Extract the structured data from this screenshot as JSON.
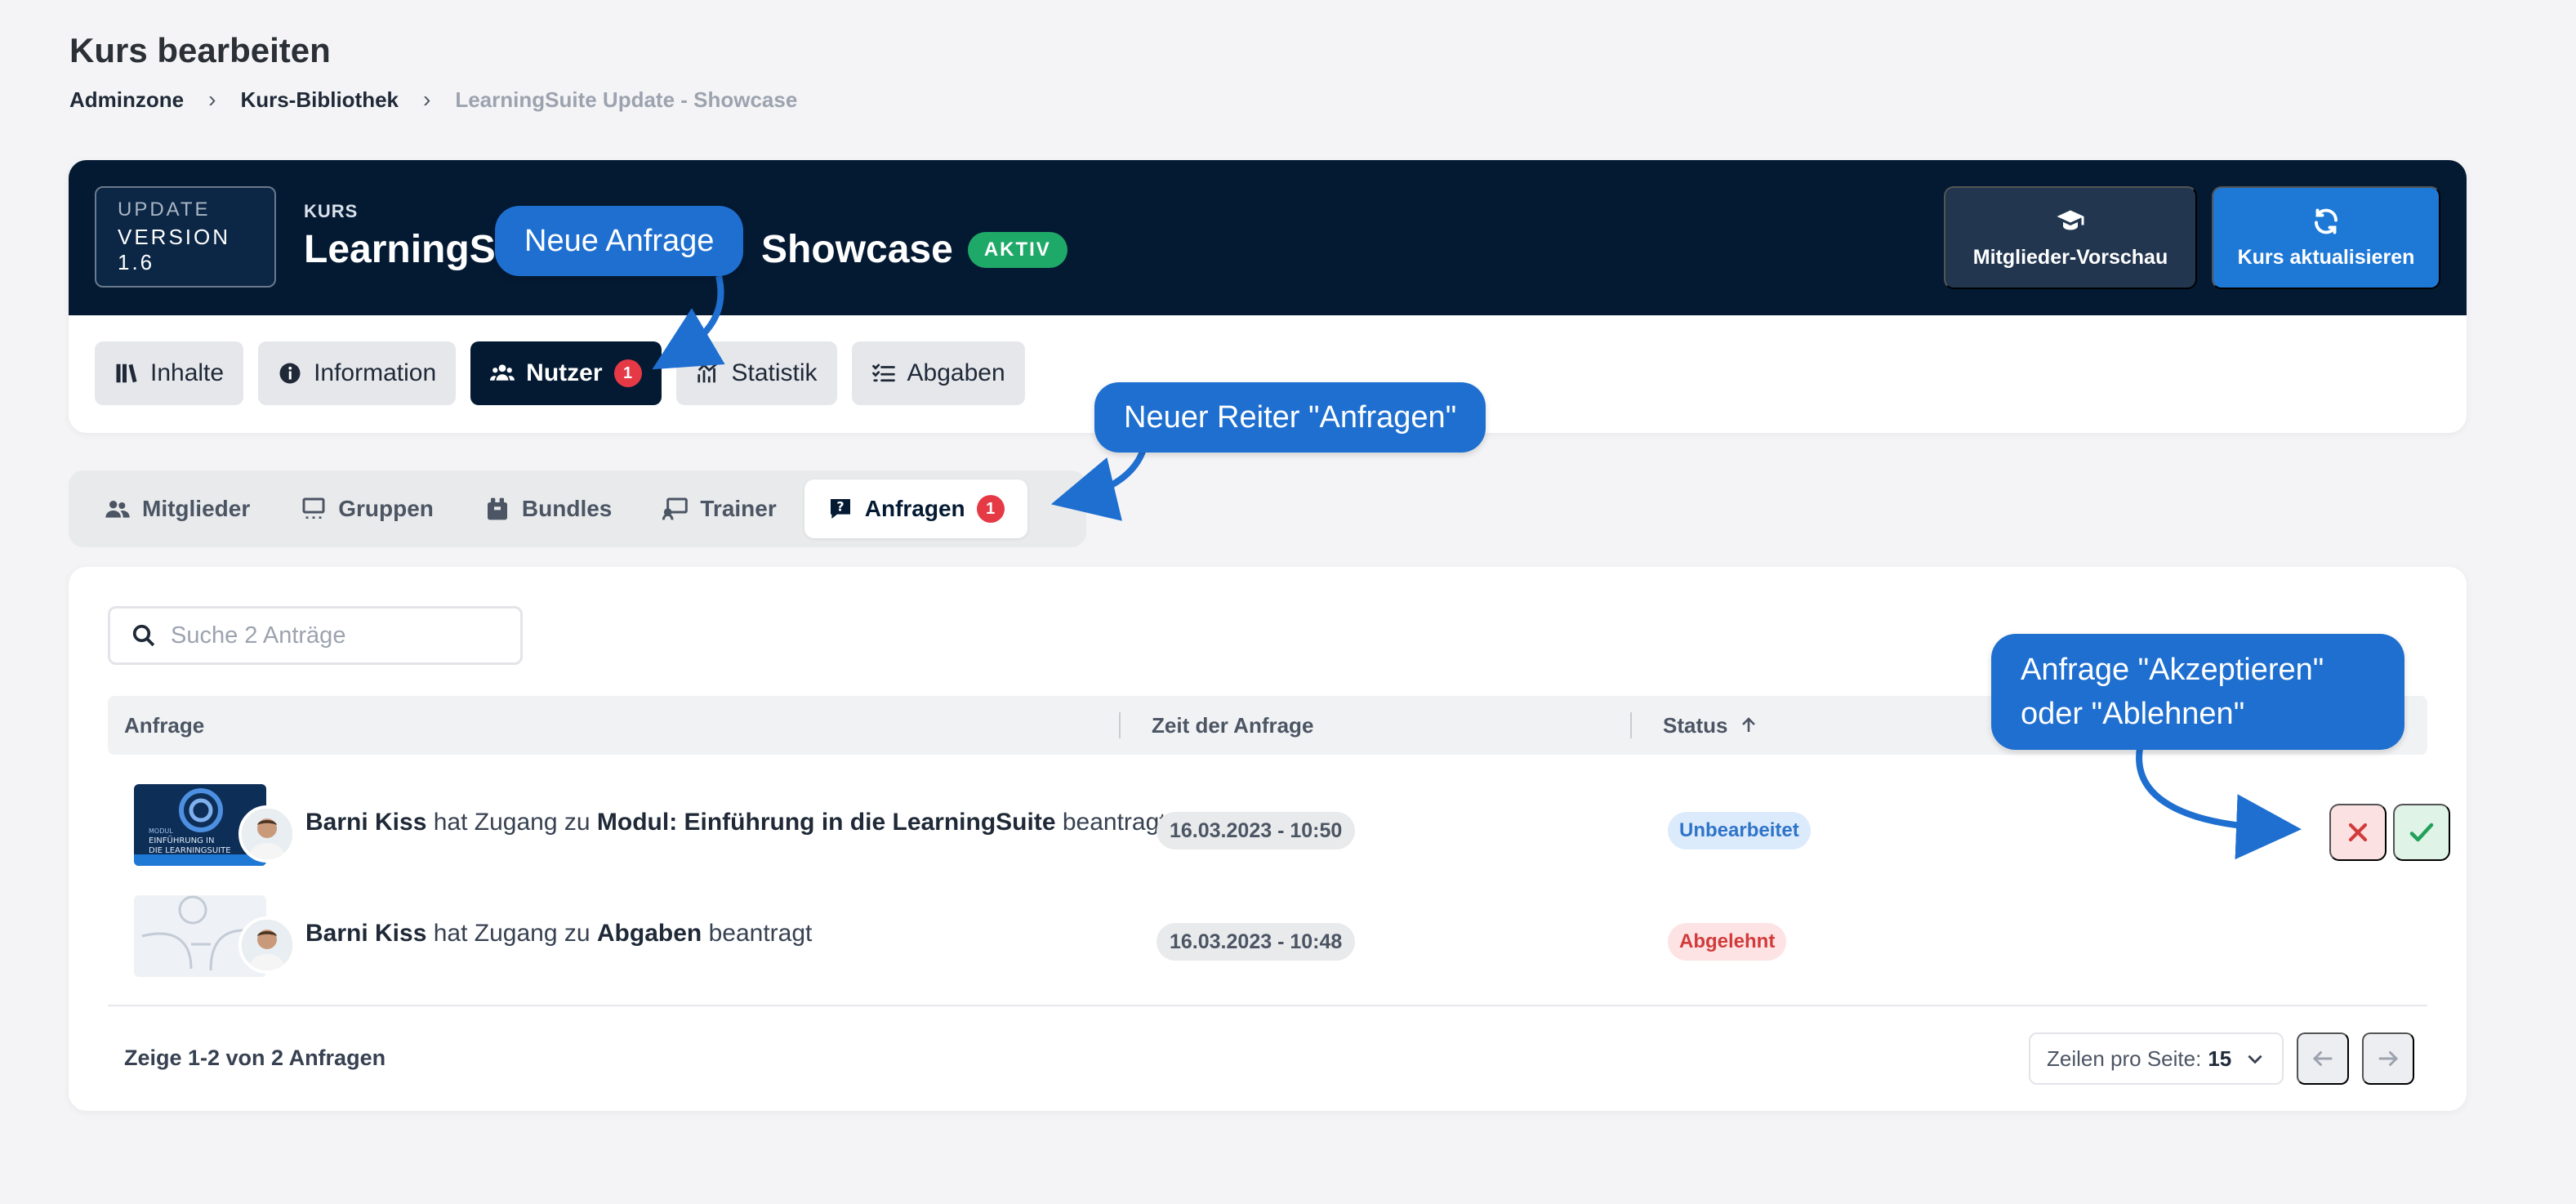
{
  "page_title": "Kurs bearbeiten",
  "breadcrumb": [
    "Adminzone",
    "Kurs-Bibliothek",
    "LearningSuite Update - Showcase"
  ],
  "course": {
    "thumb_line1": "UPDATE",
    "thumb_line2": "VERSION 1.6",
    "kicker": "KURS",
    "title_visible_left": "LearningSu",
    "title_visible_right": "Showcase",
    "status": "AKTIV",
    "preview_label": "Mitglieder-Vorschau",
    "update_label": "Kurs aktualisieren"
  },
  "main_tabs": [
    {
      "label": "Inhalte"
    },
    {
      "label": "Information"
    },
    {
      "label": "Nutzer",
      "badge": "1"
    },
    {
      "label": "Statistik"
    },
    {
      "label": "Abgaben"
    }
  ],
  "sub_tabs": [
    {
      "label": "Mitglieder"
    },
    {
      "label": "Gruppen"
    },
    {
      "label": "Bundles"
    },
    {
      "label": "Trainer"
    },
    {
      "label": "Anfragen",
      "badge": "1"
    }
  ],
  "search": {
    "placeholder": "Suche 2 Anträge"
  },
  "table": {
    "columns": [
      "Anfrage",
      "Zeit der Anfrage",
      "Status"
    ],
    "rows": [
      {
        "user": "Barni Kiss",
        "mid": "hat Zugang zu",
        "target": "Modul: Einführung in die LearningSuite",
        "end": "beantragt",
        "thumb_text1": "MODUL",
        "thumb_text2": "EINFÜHRUNG IN",
        "thumb_text3": "DIE LEARNINGSUITE",
        "time": "16.03.2023 - 10:50",
        "status": "Unbearbeitet"
      },
      {
        "user": "Barni Kiss",
        "mid": "hat Zugang zu",
        "target": "Abgaben",
        "end": "beantragt",
        "time": "16.03.2023 - 10:48",
        "status": "Abgelehnt"
      }
    ]
  },
  "footer": {
    "count": "Zeige 1-2 von 2 Anfragen",
    "rows_label": "Zeilen pro Seite:",
    "rows_value": "15"
  },
  "callouts": {
    "new_request": "Neue Anfrage",
    "new_tab": "Neuer Reiter \"Anfragen\"",
    "accept_line1": "Anfrage \"Akzeptieren\"",
    "accept_line2": "oder \"Ablehnen\""
  },
  "colors": {
    "navy": "#041a33",
    "accent": "#1e78d6",
    "callout": "#1e6fd0",
    "badge_red": "#e53946",
    "active_green": "#1fa968"
  }
}
